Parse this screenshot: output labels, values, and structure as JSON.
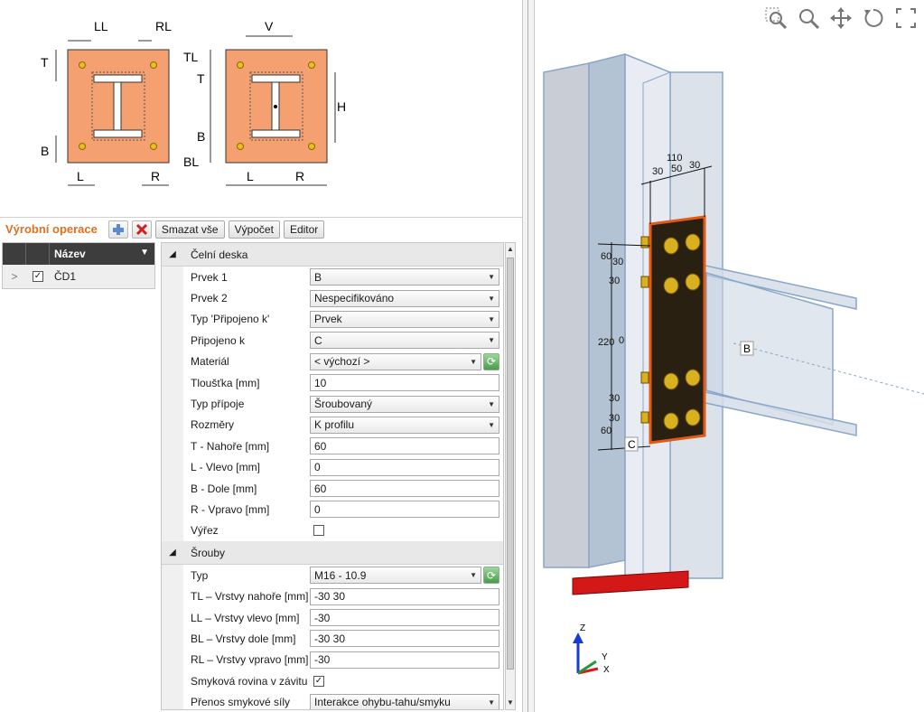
{
  "diagram": {
    "left": {
      "LL": "LL",
      "RL": "RL",
      "T": "T",
      "B": "B",
      "L": "L",
      "R": "R"
    },
    "right": {
      "V": "V",
      "TL": "TL",
      "T": "T",
      "B": "B",
      "BL": "BL",
      "H": "H",
      "L": "L",
      "R": "R"
    }
  },
  "ops": {
    "title": "Výrobní operace",
    "delete_all": "Smazat vše",
    "calc": "Výpočet",
    "editor": "Editor"
  },
  "list": {
    "header": "Název",
    "items": [
      {
        "expand": ">",
        "checked": "✓",
        "name": "ČD1"
      }
    ]
  },
  "props": {
    "section1": "Čelní deska",
    "rows1": [
      {
        "label": "Prvek 1",
        "value": "B"
      },
      {
        "label": "Prvek 2",
        "value": "Nespecifikováno"
      },
      {
        "label": "Typ 'Připojeno k'",
        "value": "Prvek"
      },
      {
        "label": "Připojeno k",
        "value": "C"
      },
      {
        "label": "Materiál",
        "value": "< výchozí >"
      },
      {
        "label": "Tloušťka [mm]",
        "value": "10"
      },
      {
        "label": "Typ přípoje",
        "value": "Šroubovaný"
      },
      {
        "label": "Rozměry",
        "value": "K profilu"
      },
      {
        "label": "T - Nahoře [mm]",
        "value": "60"
      },
      {
        "label": "L - Vlevo [mm]",
        "value": "0"
      },
      {
        "label": "B - Dole [mm]",
        "value": "60"
      },
      {
        "label": "R - Vpravo [mm]",
        "value": "0"
      },
      {
        "label": "Výřez",
        "value": ""
      }
    ],
    "section2": "Šrouby",
    "rows2": [
      {
        "label": "Typ",
        "value": "M16 - 10.9"
      },
      {
        "label": "TL – Vrstvy nahoře [mm]",
        "value": "-30 30"
      },
      {
        "label": "LL – Vrstvy vlevo [mm]",
        "value": "-30"
      },
      {
        "label": "BL – Vrstvy dole [mm]",
        "value": "-30 30"
      },
      {
        "label": "RL – Vrstvy vpravo [mm]",
        "value": "-30"
      },
      {
        "label": "Smyková rovina v závitu",
        "value": "✓"
      },
      {
        "label": "Přenos smykové síly",
        "value": "Interakce ohybu-tahu/smyku"
      }
    ]
  },
  "viewport": {
    "dims": {
      "d110": "110",
      "d30a": "30",
      "d50": "50",
      "d30b": "30",
      "d60a": "60",
      "d30c": "30",
      "d30d": "30",
      "d220": "220",
      "d0": "0",
      "d30e": "30",
      "d30f": "30",
      "d60b": "60"
    },
    "labels": {
      "B": "B",
      "C": "C"
    },
    "axes": {
      "z": "Z",
      "y": "Y",
      "x": "X"
    }
  },
  "colors": {
    "accent": "#e07020",
    "plate": "#f4a070",
    "bolt": "#d8b020",
    "member": "#b8cfe6"
  }
}
